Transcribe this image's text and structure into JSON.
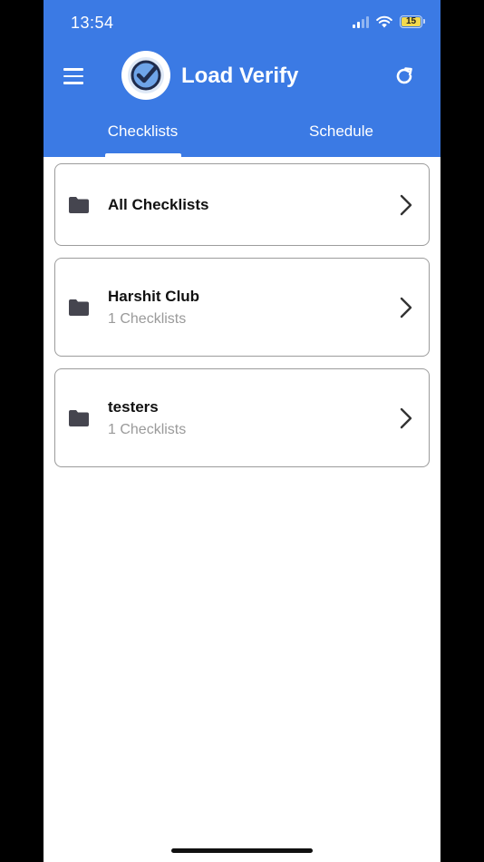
{
  "status_bar": {
    "time": "13:54",
    "battery_level": "15",
    "icons": [
      "cellular-signal-icon",
      "wifi-icon",
      "battery-icon"
    ]
  },
  "app": {
    "title": "Load Verify",
    "brand_color": "#3b7ae4",
    "icons": [
      "hamburger-menu-icon",
      "app-logo-checkmark-icon",
      "refresh-icon"
    ]
  },
  "tabs": [
    {
      "label": "Checklists",
      "active": true
    },
    {
      "label": "Schedule",
      "active": false
    }
  ],
  "folders": [
    {
      "title": "All Checklists",
      "subtitle": ""
    },
    {
      "title": "Harshit Club",
      "subtitle": "1 Checklists"
    },
    {
      "title": "testers",
      "subtitle": "1 Checklists"
    }
  ]
}
